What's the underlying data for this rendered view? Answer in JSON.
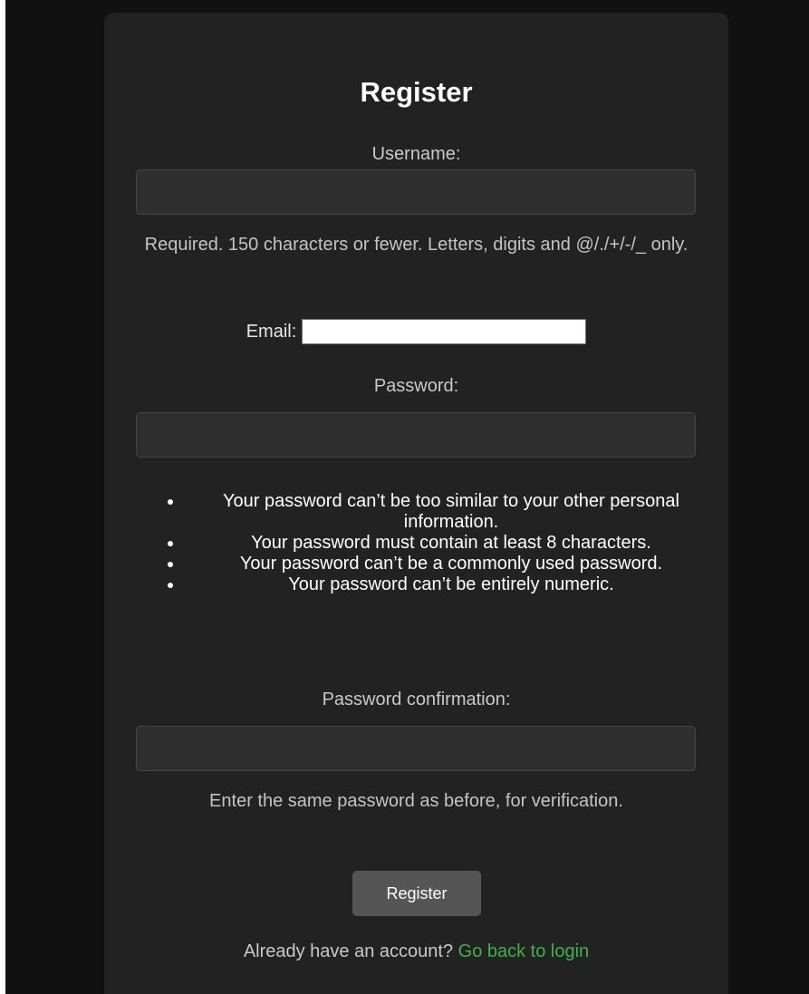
{
  "form": {
    "title": "Register",
    "username": {
      "label": "Username:",
      "value": "",
      "help": "Required. 150 characters or fewer. Letters, digits and @/./+/-/_ only."
    },
    "email": {
      "label": "Email:",
      "value": ""
    },
    "password": {
      "label": "Password:",
      "value": "",
      "rules": [
        "Your password can’t be too similar to your other personal information.",
        "Your password must contain at least 8 characters.",
        "Your password can’t be a commonly used password.",
        "Your password can’t be entirely numeric."
      ]
    },
    "password_confirmation": {
      "label": "Password confirmation:",
      "value": "",
      "help": "Enter the same password as before, for verification."
    },
    "submit_label": "Register"
  },
  "footer": {
    "text": "Already have an account? ",
    "link_label": "Go back to login"
  },
  "colors": {
    "page_background": "#111111",
    "card_background": "#222222",
    "input_background": "#2e2e2e",
    "button_background": "#555555",
    "link": "#3cb34a"
  }
}
